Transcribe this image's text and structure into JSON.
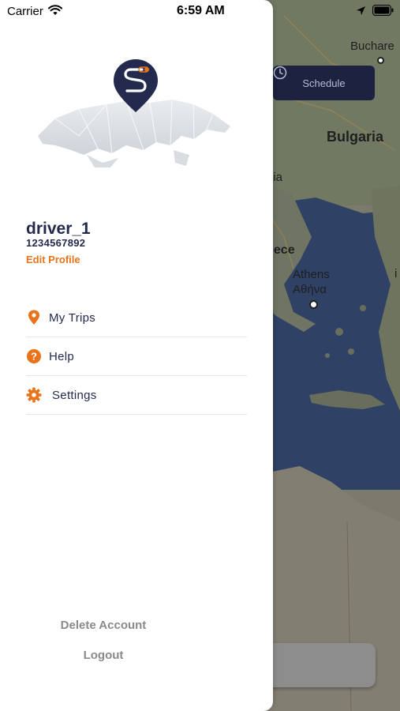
{
  "status_bar": {
    "carrier": "Carrier",
    "time": "6:59 AM"
  },
  "map": {
    "labels": {
      "bucharest": "Buchare",
      "bulgaria": "Bulgaria",
      "nia": "nia",
      "greece": "eece",
      "athens": "Athens",
      "athens_greek": "Αθήνα",
      "partial": "i"
    },
    "schedule_label": "Schedule",
    "colors": {
      "land": "#d2cbb8",
      "sea": "#4c66a1",
      "land_dim": "#8f8b80"
    }
  },
  "drawer": {
    "user": {
      "name": "driver_1",
      "phone": "1234567892",
      "edit_label": "Edit Profile"
    },
    "menu": [
      {
        "label": "My Trips",
        "icon": "location-pin-icon"
      },
      {
        "label": "Help",
        "icon": "help-circle-icon"
      },
      {
        "label": "Settings",
        "icon": "gear-icon"
      }
    ],
    "delete_account_label": "Delete Account",
    "logout_label": "Logout"
  },
  "colors": {
    "accent": "#e8731a",
    "navy": "#232a4e",
    "muted": "#8a8a8a"
  }
}
